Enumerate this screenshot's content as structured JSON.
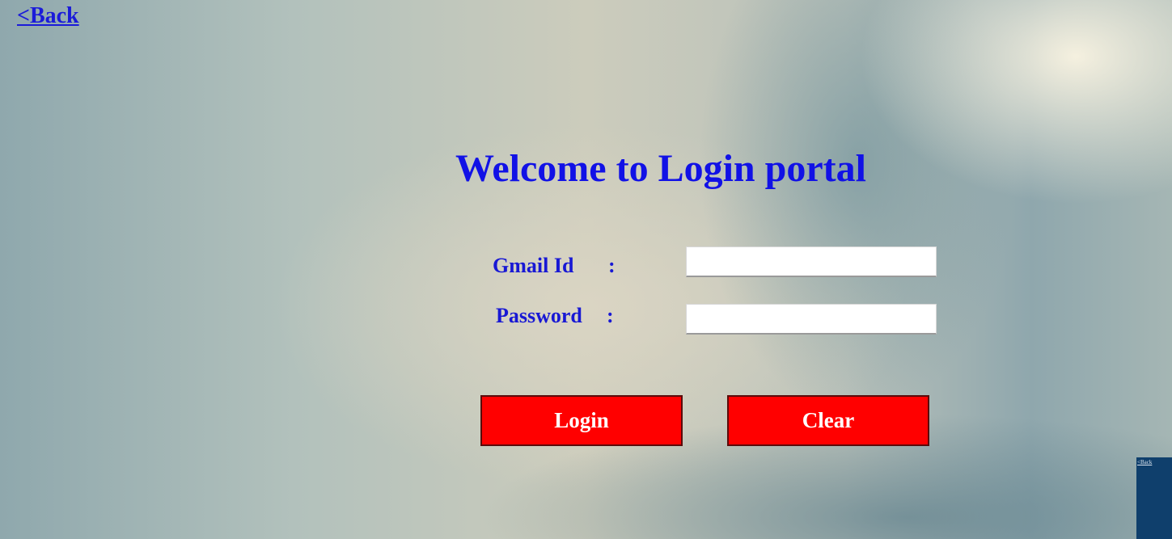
{
  "nav": {
    "back_label": "<Back"
  },
  "title": "Welcome to Login portal",
  "form": {
    "email": {
      "label": "Gmail Id",
      "colon": ":",
      "value": "",
      "placeholder": ""
    },
    "password": {
      "label": "Password",
      "colon": ":",
      "value": "",
      "placeholder": ""
    }
  },
  "buttons": {
    "login_label": "Login",
    "clear_label": "Clear"
  },
  "corner_preview": {
    "back_label": "<Back"
  },
  "colors": {
    "link": "#1b1bd9",
    "title": "#1111e6",
    "label": "#1818d4",
    "button_bg": "#ff0000",
    "button_text": "#ffffff",
    "corner_panel": "#0f3f6c"
  }
}
